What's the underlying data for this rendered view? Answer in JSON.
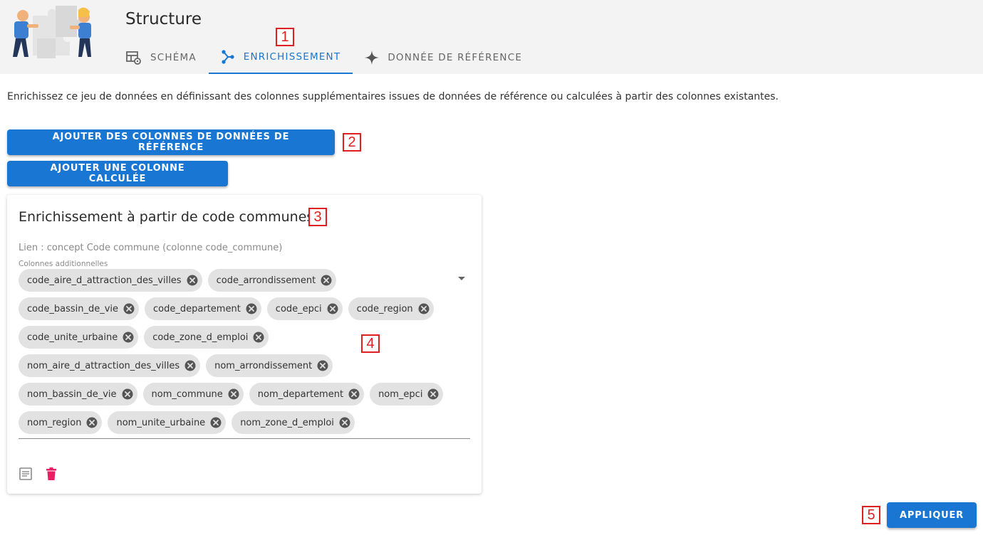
{
  "header": {
    "title": "Structure",
    "tabs": [
      {
        "label": "SCHÉMA",
        "icon": "table-cog-icon",
        "active": false
      },
      {
        "label": "ENRICHISSEMENT",
        "icon": "source-branch-icon",
        "active": true
      },
      {
        "label": "DONNÉE DE RÉFÉRENCE",
        "icon": "star-four-points-icon",
        "active": false
      }
    ]
  },
  "intro": "Enrichissez ce jeu de données en définissant des colonnes supplémentaires issues de données de référence ou calculées à partir des colonnes existantes.",
  "actions": {
    "add_reference_label": "AJOUTER DES COLONNES DE DONNÉES DE RÉFÉRENCE",
    "add_computed_label": "AJOUTER UNE COLONNE CALCULÉE",
    "apply_label": "APPLIQUER"
  },
  "card": {
    "title": "Enrichissement à partir de code communes",
    "link": "Lien : concept Code commune (colonne code_commune)",
    "field_label": "Colonnes additionnelles",
    "chips": [
      "code_aire_d_attraction_des_villes",
      "code_arrondissement",
      "code_bassin_de_vie",
      "code_departement",
      "code_epci",
      "code_region",
      "code_unite_urbaine",
      "code_zone_d_emploi",
      "nom_aire_d_attraction_des_villes",
      "nom_arrondissement",
      "nom_bassin_de_vie",
      "nom_commune",
      "nom_departement",
      "nom_epci",
      "nom_region",
      "nom_unite_urbaine",
      "nom_zone_d_emploi"
    ]
  },
  "markers": [
    "1",
    "2",
    "3",
    "4",
    "5"
  ],
  "colors": {
    "primary": "#1976d2",
    "danger": "#e91e63",
    "marker": "#e02020",
    "topbar": "#f3f3f3"
  }
}
